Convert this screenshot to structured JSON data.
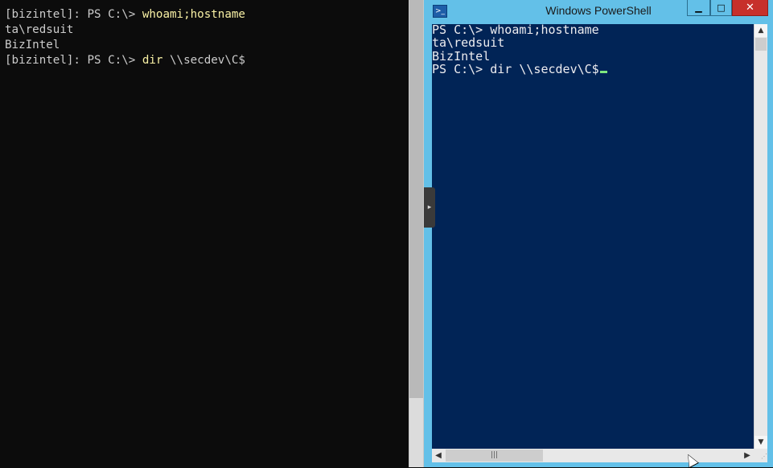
{
  "left_terminal": {
    "lines": [
      {
        "prompt": "[bizintel]: PS C:\\> ",
        "command": "whoami;hostname"
      },
      {
        "output": "ta\\redsuit"
      },
      {
        "output": "BizIntel"
      },
      {
        "prompt": "[bizintel]: PS C:\\> ",
        "command_keyword": "dir",
        "command_args": " \\\\secdev\\C$"
      }
    ]
  },
  "ps_window": {
    "title": "Windows PowerShell",
    "icon": "powershell-icon",
    "buttons": {
      "minimize": "▁",
      "maximize": "□",
      "close": "✕"
    },
    "console_lines": [
      "PS C:\\> whoami;hostname",
      "ta\\redsuit",
      "BizIntel",
      "PS C:\\> dir \\\\secdev\\C$"
    ],
    "colors": {
      "console_bg": "#012456",
      "frame": "#63c0e8",
      "cursor": "#7fe87f"
    }
  },
  "splitter_arrow": "▸"
}
